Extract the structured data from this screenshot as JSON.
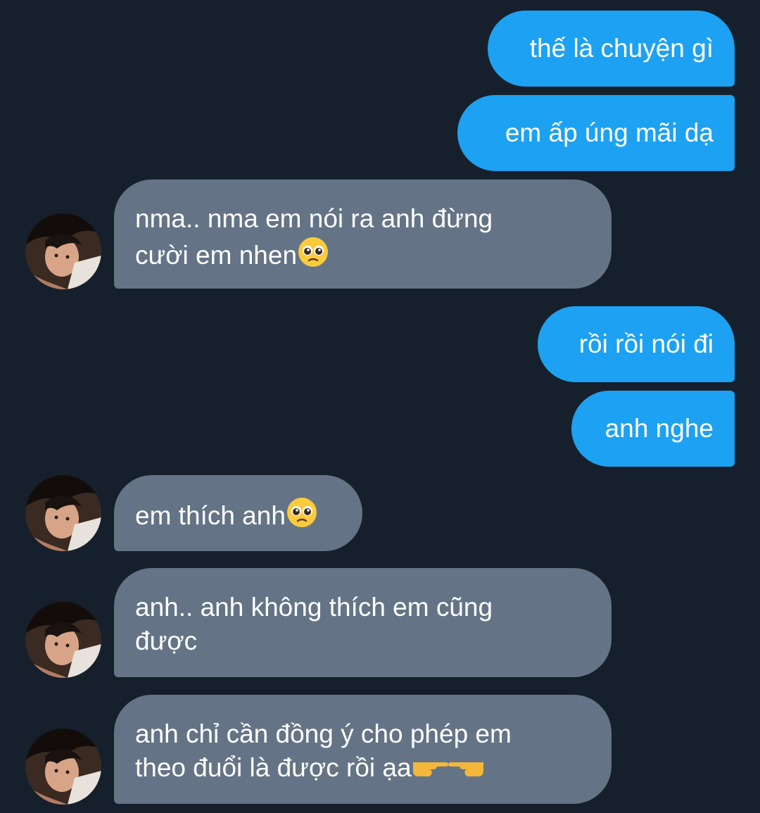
{
  "conversation": {
    "messages": [
      {
        "side": "sent",
        "text": "thế là chuyện gì"
      },
      {
        "side": "sent",
        "text": "em ấp úng mãi dạ"
      },
      {
        "side": "received",
        "lines": [
          "nma.. nma em nói ra anh đừng",
          "cười em nhen"
        ],
        "emoji": "pleading-face"
      },
      {
        "side": "sent",
        "text": "rồi rồi nói đi"
      },
      {
        "side": "sent",
        "text": "anh nghe"
      },
      {
        "side": "received",
        "lines": [
          "em thích anh"
        ],
        "emoji": "pleading-face"
      },
      {
        "side": "received",
        "lines": [
          "anh.. anh không thích em cũng",
          "được"
        ]
      },
      {
        "side": "received",
        "lines": [
          "anh chỉ cần đồng ý cho phép em",
          "theo đuổi là được rồi ạa"
        ],
        "emoji": "pointing-fingers"
      }
    ]
  },
  "colors": {
    "background": "#16202c",
    "sent_bubble": "#1da1f2",
    "received_bubble": "#647486",
    "text": "#ffffff"
  },
  "avatar_icon": "profile-photo"
}
